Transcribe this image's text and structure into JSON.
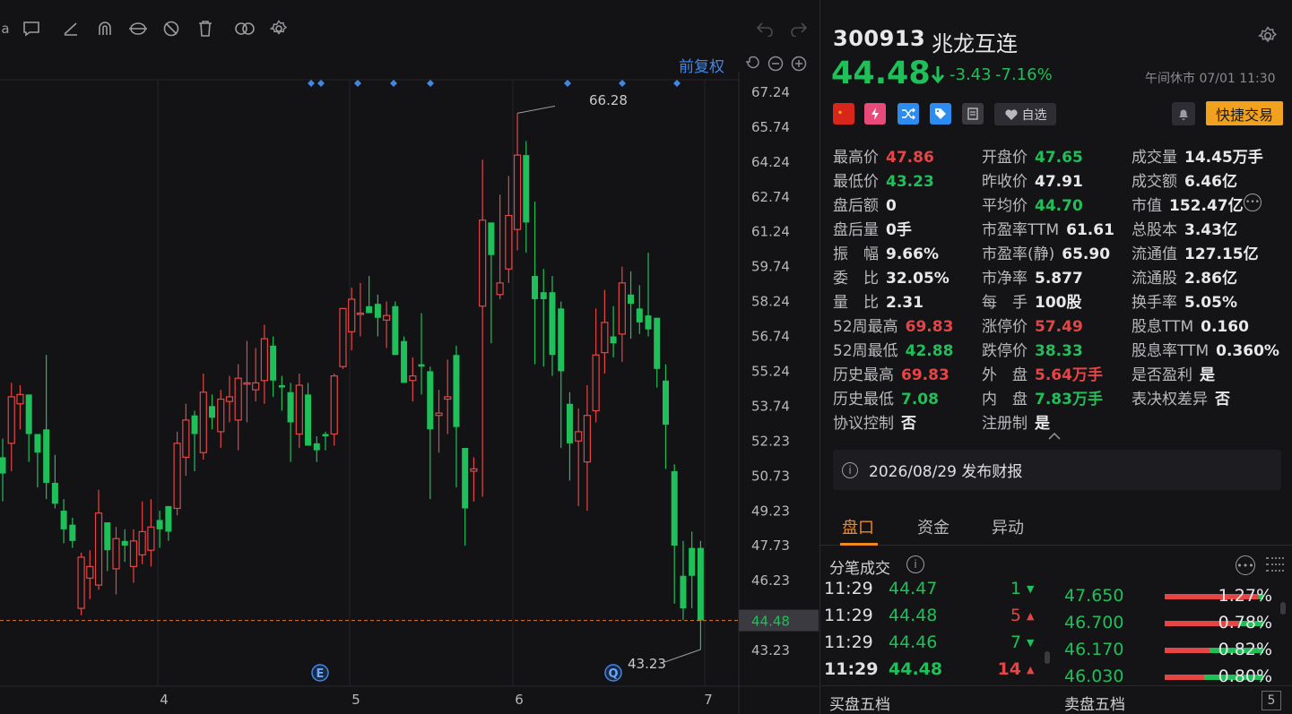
{
  "chart": {
    "adjust_label": "前复权",
    "price_ticks": [
      "67.24",
      "65.74",
      "64.24",
      "62.74",
      "61.24",
      "59.74",
      "58.24",
      "56.74",
      "55.24",
      "53.74",
      "52.23",
      "50.73",
      "49.23",
      "47.73",
      "46.23",
      "44.48",
      "43.23"
    ],
    "current_price_tag": "44.48",
    "date_labels": [
      "4",
      "5",
      "6",
      "7"
    ],
    "high_annotation": "66.28",
    "low_annotation": "43.23",
    "event_markers": [
      "E",
      "Q"
    ],
    "colors": {
      "up": "#e64545",
      "down": "#1fbf5a",
      "grid": "#26262b",
      "current_line": "#e07a2b",
      "marker": "#3f87e6"
    }
  },
  "chart_data": {
    "type": "candlestick",
    "price_range": [
      42.5,
      67.9
    ],
    "x_ticks": [
      "4",
      "5",
      "6",
      "7"
    ],
    "bars": [
      [
        51.5,
        50.8,
        52.3,
        49.6
      ],
      [
        52.1,
        54.1,
        54.7,
        50.9
      ],
      [
        53.8,
        54.2,
        54.6,
        52.7
      ],
      [
        54.2,
        52.5,
        53.8,
        51.3
      ],
      [
        52.5,
        51.7,
        52.1,
        50.2
      ],
      [
        52.7,
        50.4,
        55.9,
        49.7
      ],
      [
        50.4,
        49.5,
        51.6,
        49.3
      ],
      [
        49.2,
        48.4,
        49.7,
        47.8
      ],
      [
        48.6,
        47.9,
        48.9,
        47.6
      ],
      [
        45.0,
        47.2,
        47.4,
        44.7
      ],
      [
        46.3,
        46.8,
        47.5,
        45.4
      ],
      [
        46.0,
        49.1,
        50.1,
        45.8
      ],
      [
        48.7,
        47.5,
        48.7,
        46.6
      ],
      [
        46.7,
        48.0,
        48.5,
        45.6
      ],
      [
        47.9,
        47.7,
        48.4,
        47.0
      ],
      [
        46.8,
        47.9,
        48.4,
        46.1
      ],
      [
        47.3,
        48.3,
        49.6,
        46.9
      ],
      [
        47.5,
        48.5,
        49.7,
        46.8
      ],
      [
        48.8,
        48.4,
        49.2,
        47.6
      ],
      [
        49.4,
        48.3,
        48.9,
        47.9
      ],
      [
        49.3,
        52.1,
        52.6,
        49.0
      ],
      [
        51.5,
        53.1,
        53.8,
        50.7
      ],
      [
        53.3,
        52.5,
        53.5,
        50.9
      ],
      [
        51.7,
        54.3,
        55.1,
        51.4
      ],
      [
        53.7,
        53.2,
        54.2,
        52.7
      ],
      [
        52.6,
        54.0,
        54.4,
        51.9
      ],
      [
        53.9,
        54.1,
        55.0,
        53.0
      ],
      [
        53.1,
        54.9,
        55.5,
        51.8
      ],
      [
        54.7,
        54.7,
        56.5,
        53.0
      ],
      [
        54.4,
        54.7,
        56.2,
        53.9
      ],
      [
        54.8,
        56.6,
        57.2,
        53.8
      ],
      [
        56.3,
        54.8,
        56.7,
        54.1
      ],
      [
        54.6,
        54.5,
        55.0,
        53.5
      ],
      [
        54.3,
        53.0,
        54.7,
        51.3
      ],
      [
        52.5,
        54.6,
        55.1,
        51.9
      ],
      [
        54.2,
        52.0,
        54.7,
        52.0
      ],
      [
        52.1,
        51.8,
        52.4,
        51.3
      ],
      [
        52.5,
        52.4,
        52.6,
        51.8
      ],
      [
        52.5,
        55.0,
        55.1,
        52.0
      ],
      [
        55.4,
        57.9,
        57.2,
        55.3
      ],
      [
        56.9,
        58.3,
        58.8,
        56.1
      ],
      [
        57.7,
        57.7,
        59.0,
        56.7
      ],
      [
        58.0,
        57.7,
        59.3,
        57.7
      ],
      [
        58.1,
        57.5,
        58.5,
        56.7
      ],
      [
        57.4,
        57.6,
        58.2,
        56.2
      ],
      [
        58.0,
        55.9,
        58.2,
        55.9
      ],
      [
        56.5,
        54.7,
        56.7,
        54.7
      ],
      [
        54.8,
        55.0,
        55.8,
        53.9
      ],
      [
        55.5,
        55.4,
        57.7,
        54.2
      ],
      [
        55.2,
        52.7,
        55.4,
        49.7
      ],
      [
        53.3,
        53.4,
        54.4,
        51.7
      ],
      [
        54.0,
        54.1,
        55.7,
        52.5
      ],
      [
        55.9,
        52.8,
        56.3,
        50.2
      ],
      [
        51.9,
        49.3,
        51.9,
        47.7
      ],
      [
        50.9,
        51.0,
        51.5,
        49.6
      ],
      [
        58.0,
        61.7,
        64.3,
        49.8
      ],
      [
        61.6,
        60.2,
        61.6,
        56.4
      ],
      [
        58.5,
        59.0,
        62.8,
        58.3
      ],
      [
        59.6,
        61.9,
        63.6,
        59.0
      ],
      [
        61.3,
        64.5,
        66.3,
        60.4
      ],
      [
        64.5,
        61.6,
        65.1,
        60.3
      ],
      [
        59.3,
        58.3,
        62.5,
        55.5
      ],
      [
        58.6,
        58.3,
        59.6,
        55.4
      ],
      [
        58.6,
        55.9,
        59.3,
        55.0
      ],
      [
        57.9,
        55.2,
        58.2,
        51.9
      ],
      [
        53.8,
        52.1,
        54.3,
        50.5
      ],
      [
        52.2,
        52.6,
        53.6,
        49.4
      ],
      [
        51.3,
        53.3,
        54.6,
        49.2
      ],
      [
        53.5,
        55.9,
        57.9,
        53.0
      ],
      [
        56.0,
        57.3,
        58.7,
        55.1
      ],
      [
        56.7,
        56.4,
        58.0,
        55.8
      ],
      [
        56.8,
        59.0,
        59.7,
        55.6
      ],
      [
        58.5,
        58.1,
        59.5,
        56.6
      ],
      [
        57.9,
        57.3,
        58.9,
        56.8
      ],
      [
        57.6,
        57.0,
        60.3,
        56.7
      ],
      [
        57.5,
        55.3,
        57.5,
        54.5
      ],
      [
        54.8,
        52.9,
        55.5,
        51.0
      ],
      [
        50.9,
        47.7,
        51.2,
        45.2
      ],
      [
        46.4,
        45.0,
        47.9,
        44.5
      ],
      [
        47.6,
        46.4,
        48.3,
        45.0
      ],
      [
        47.6,
        44.48,
        47.9,
        43.23
      ]
    ]
  },
  "quote": {
    "code": "300913",
    "name": "兆龙互连",
    "price": "44.48",
    "change": "-3.43",
    "change_pct": "-7.16%",
    "status_time": "午间休市 07/01 11:30",
    "watch_label": "自选",
    "trade_label": "快捷交易",
    "badges": [
      "cn-flag-icon",
      "lightning-icon",
      "shuffle-icon",
      "tag-icon",
      "doc-icon"
    ]
  },
  "stats": {
    "col1": [
      {
        "label": "最高价",
        "value": "47.86",
        "color": "red"
      },
      {
        "label": "最低价",
        "value": "43.23",
        "color": "green"
      },
      {
        "label": "盘后额",
        "value": "0",
        "color": "white"
      },
      {
        "label": "盘后量",
        "value": "0手",
        "color": "white"
      },
      {
        "label": "振　幅",
        "value": "9.66%",
        "color": "white"
      },
      {
        "label": "委　比",
        "value": "32.05%",
        "color": "white"
      },
      {
        "label": "量　比",
        "value": "2.31",
        "color": "white"
      },
      {
        "label": "52周最高",
        "value": "69.83",
        "color": "red"
      },
      {
        "label": "52周最低",
        "value": "42.88",
        "color": "green"
      },
      {
        "label": "历史最高",
        "value": "69.83",
        "color": "red"
      },
      {
        "label": "历史最低",
        "value": "7.08",
        "color": "green"
      },
      {
        "label": "协议控制",
        "value": "否",
        "color": "white"
      }
    ],
    "col2": [
      {
        "label": "开盘价",
        "value": "47.65",
        "color": "green"
      },
      {
        "label": "昨收价",
        "value": "47.91",
        "color": "white"
      },
      {
        "label": "平均价",
        "value": "44.70",
        "color": "green"
      },
      {
        "label": "市盈率TTM",
        "value": "61.61",
        "color": "white"
      },
      {
        "label": "市盈率(静)",
        "value": "65.90",
        "color": "white"
      },
      {
        "label": "市净率",
        "value": "5.877",
        "color": "white"
      },
      {
        "label": "每　手",
        "value": "100股",
        "color": "white"
      },
      {
        "label": "涨停价",
        "value": "57.49",
        "color": "red"
      },
      {
        "label": "跌停价",
        "value": "38.33",
        "color": "green"
      },
      {
        "label": "外　盘",
        "value": "5.64万手",
        "color": "red"
      },
      {
        "label": "内　盘",
        "value": "7.83万手",
        "color": "green"
      },
      {
        "label": "注册制",
        "value": "是",
        "color": "white"
      }
    ],
    "col3": [
      {
        "label": "成交量",
        "value": "14.45万手",
        "color": "white"
      },
      {
        "label": "成交额",
        "value": "6.46亿",
        "color": "white"
      },
      {
        "label": "市值",
        "value": "152.47亿",
        "color": "white"
      },
      {
        "label": "总股本",
        "value": "3.43亿",
        "color": "white"
      },
      {
        "label": "流通值",
        "value": "127.15亿",
        "color": "white"
      },
      {
        "label": "流通股",
        "value": "2.86亿",
        "color": "white"
      },
      {
        "label": "换手率",
        "value": "5.05%",
        "color": "white"
      },
      {
        "label": "股息TTM",
        "value": "0.160",
        "color": "white"
      },
      {
        "label": "股息率TTM",
        "value": "0.360%",
        "color": "white"
      },
      {
        "label": "是否盈利",
        "value": "是",
        "color": "white"
      },
      {
        "label": "表决权差异",
        "value": "否",
        "color": "white"
      }
    ]
  },
  "earnings_notice": "2026/08/29  发布财报",
  "tabs": [
    "盘口",
    "资金",
    "异动"
  ],
  "ticks": {
    "title": "分笔成交",
    "rows": [
      {
        "time": "11:29",
        "price": "44.47",
        "vol": "1",
        "dir": "down"
      },
      {
        "time": "11:29",
        "price": "44.48",
        "vol": "5",
        "dir": "up"
      },
      {
        "time": "11:29",
        "price": "44.46",
        "vol": "7",
        "dir": "down"
      },
      {
        "time": "11:29",
        "price": "44.48",
        "vol": "14",
        "dir": "up"
      }
    ]
  },
  "distribution": [
    {
      "price": "47.650",
      "pct": "1.27%",
      "green_share": 0.05
    },
    {
      "price": "46.700",
      "pct": "0.78%",
      "green_share": 0.25
    },
    {
      "price": "46.170",
      "pct": "0.82%",
      "green_share": 0.55
    },
    {
      "price": "46.030",
      "pct": "0.80%",
      "green_share": 0.6
    }
  ],
  "bottom": {
    "buy_label": "买盘五档",
    "sell_label": "卖盘五档",
    "levels": "5"
  }
}
